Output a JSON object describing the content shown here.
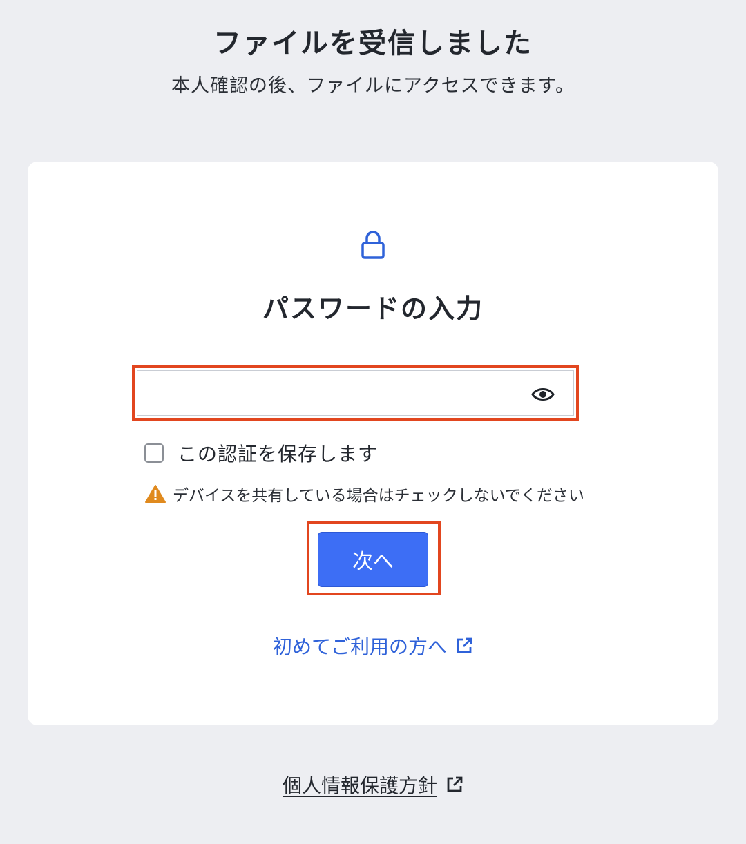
{
  "header": {
    "title": "ファイルを受信しました",
    "subtitle": "本人確認の後、ファイルにアクセスできます。"
  },
  "card": {
    "lock_icon": "lock-icon",
    "title": "パスワードの入力",
    "password": {
      "value": "",
      "placeholder": "",
      "toggle_icon": "eye-icon"
    },
    "remember": {
      "label": "この認証を保存します",
      "checked": false
    },
    "warning": {
      "icon": "warning-triangle-icon",
      "text": "デバイスを共有している場合はチェックしないでください"
    },
    "next_button": {
      "label": "次へ"
    },
    "first_time_link": {
      "label": "初めてご利用の方へ",
      "icon": "external-link-icon"
    }
  },
  "footer": {
    "privacy_link": {
      "label": "個人情報保護方針",
      "icon": "external-link-icon"
    }
  },
  "colors": {
    "background": "#edeef2",
    "primary": "#3d6ef5",
    "link": "#2f62d9",
    "highlight": "#e2461f",
    "warning": "#e08a1e"
  }
}
